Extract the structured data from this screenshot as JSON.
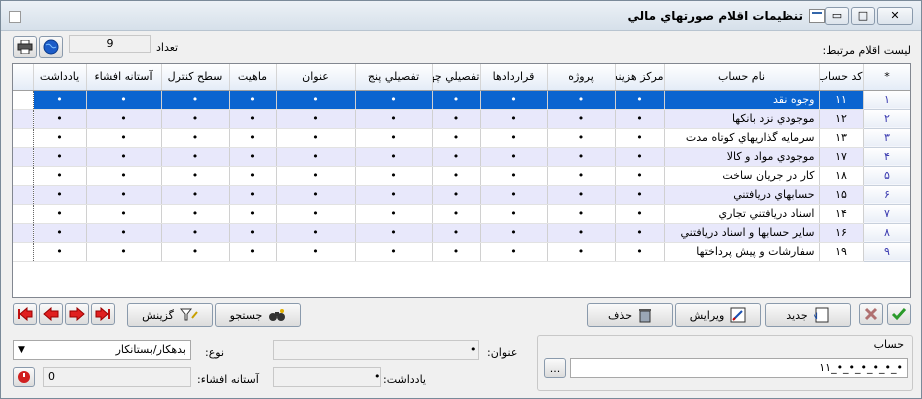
{
  "window": {
    "title": "تنظيمات اقلام صورتهاي مالي"
  },
  "header": {
    "linked_items_label": "ليست اقلام مرتبط:",
    "count_label": "تعداد",
    "count_value": "9"
  },
  "table": {
    "columns": [
      "*",
      "كد حساب",
      "نام حساب",
      "مركز هزينه",
      "پروژه",
      "قراردادها",
      "تفصيلي چهار",
      "تفصيلي پنج",
      "عنوان",
      "ماهيت",
      "سطح كنترل",
      "آستانه افشاء",
      "يادداشت"
    ],
    "rows": [
      {
        "index": "۱",
        "code": "۱۱",
        "name": "وجوه نقد"
      },
      {
        "index": "۲",
        "code": "۱۲",
        "name": "موجودي نزد بانكها"
      },
      {
        "index": "۳",
        "code": "۱۳",
        "name": "سرمايه گذاريهاي كوتاه مدت"
      },
      {
        "index": "۴",
        "code": "۱۷",
        "name": "موجودي مواد و كالا"
      },
      {
        "index": "۵",
        "code": "۱۸",
        "name": "كار در جريان ساخت"
      },
      {
        "index": "۶",
        "code": "۱۵",
        "name": "حسابهاي دريافتني"
      },
      {
        "index": "۷",
        "code": "۱۴",
        "name": "اسناد دريافتني تجاري"
      },
      {
        "index": "۸",
        "code": "۱۶",
        "name": "ساير حسابها و اسناد دريافتني"
      },
      {
        "index": "۹",
        "code": "۱۹",
        "name": "سفارشات و پيش پرداختها"
      }
    ],
    "cell_placeholder": "•"
  },
  "toolbar": {
    "search_label": "جستجو",
    "filter_label": "گزينش",
    "delete_label": "حذف",
    "edit_label": "ويرايش",
    "new_label": "جديد"
  },
  "form": {
    "type_label": "نوع:",
    "type_value": "بدهكار/بستانكار",
    "threshold_label": "آستانه افشاء:",
    "threshold_value": "0",
    "title_label": "عنوان:",
    "title_value": "•",
    "note_label": "يادداشت:",
    "note_value": "•",
    "account_group_label": "حساب",
    "account_value": "۱۱_•_•_•_•_•_•",
    "browse_label": "..."
  },
  "colors": {
    "selection": "#0a64d0",
    "alt_row": "#e8e8fb",
    "nav_arrow": "#c01010"
  }
}
